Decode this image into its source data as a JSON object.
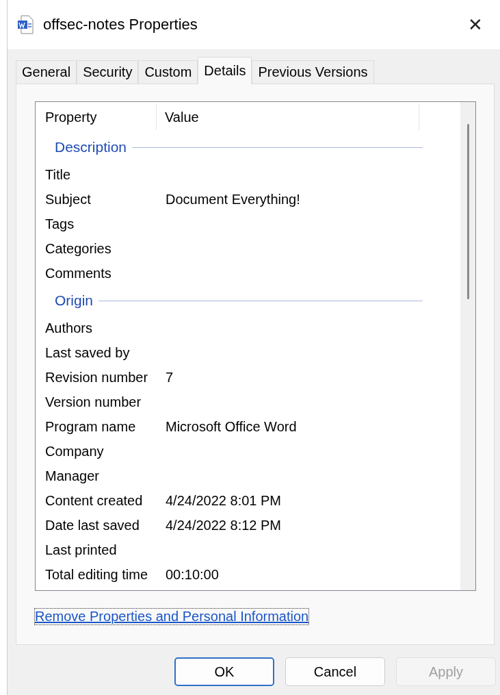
{
  "window": {
    "title": "offsec-notes Properties",
    "close": "✕"
  },
  "tabs": [
    {
      "label": "General",
      "selected": false
    },
    {
      "label": "Security",
      "selected": false
    },
    {
      "label": "Custom",
      "selected": false
    },
    {
      "label": "Details",
      "selected": true
    },
    {
      "label": "Previous Versions",
      "selected": false
    }
  ],
  "list": {
    "columns": [
      "Property",
      "Value"
    ],
    "groups": [
      {
        "title": "Description",
        "rows": [
          {
            "property": "Title"
          },
          {
            "property": "Subject",
            "value": "Document Everything!"
          },
          {
            "property": "Tags"
          },
          {
            "property": "Categories"
          },
          {
            "property": "Comments"
          }
        ]
      },
      {
        "title": "Origin",
        "rows": [
          {
            "property": "Authors"
          },
          {
            "property": "Last saved by"
          },
          {
            "property": "Revision number",
            "value": "7"
          },
          {
            "property": "Version number"
          },
          {
            "property": "Program name",
            "value": "Microsoft Office Word"
          },
          {
            "property": "Company"
          },
          {
            "property": "Manager"
          },
          {
            "property": "Content created",
            "value": "4/24/2022 8:01 PM"
          },
          {
            "property": "Date last saved",
            "value": "4/24/2022 8:12 PM"
          },
          {
            "property": "Last printed"
          },
          {
            "property": "Total editing time",
            "value": "00:10:00"
          }
        ]
      }
    ]
  },
  "link": "Remove Properties and Personal Information",
  "buttons": [
    {
      "label": "OK",
      "default": true,
      "disabled": false
    },
    {
      "label": "Cancel",
      "default": false,
      "disabled": false
    },
    {
      "label": "Apply",
      "default": false,
      "disabled": true
    }
  ]
}
